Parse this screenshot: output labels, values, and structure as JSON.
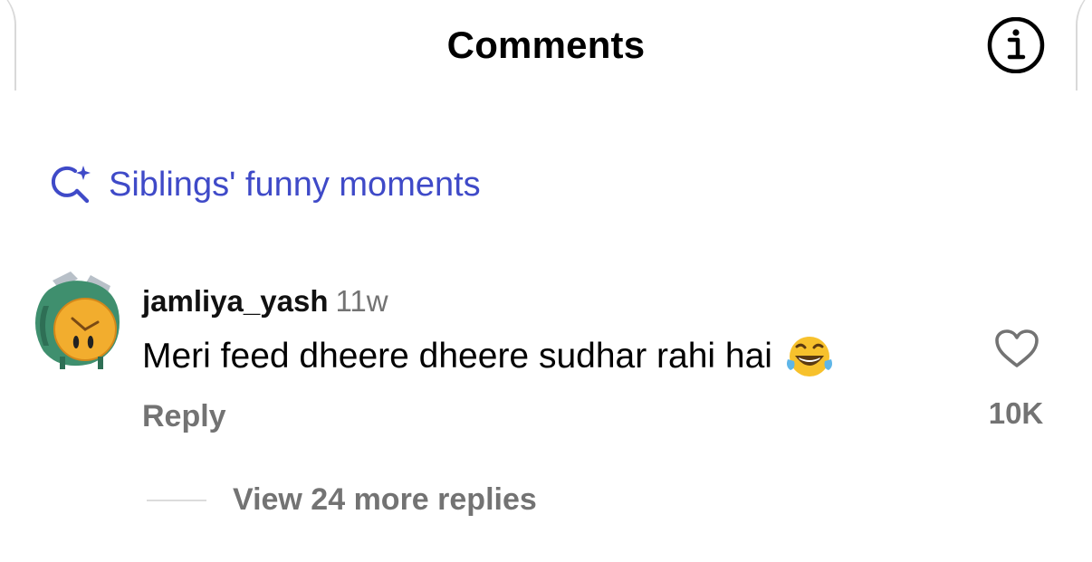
{
  "header": {
    "title": "Comments",
    "info_icon": "info-icon"
  },
  "search_suggestion": {
    "icon": "sparkle-search-icon",
    "label": "Siblings' funny moments",
    "color": "#3f4ac8"
  },
  "comment": {
    "avatar_icon": "alarm-clock-avatar",
    "username": "jamliya_yash",
    "time": "11w",
    "text": "Meri feed dheere dheere sudhar rahi hai",
    "emoji": "face-with-tears-of-joy-emoji",
    "reply_label": "Reply",
    "like_icon": "heart-icon",
    "like_count": "10K",
    "view_replies_label": "View 24 more replies"
  },
  "colors": {
    "secondary_text": "#737373",
    "accent": "#3f4ac8"
  }
}
